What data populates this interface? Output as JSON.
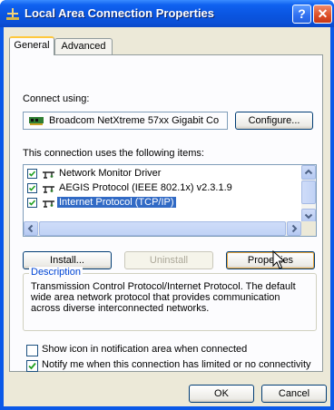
{
  "window": {
    "title": "Local Area Connection Properties",
    "help_label": "?",
    "close_label": "✕"
  },
  "tabs": [
    {
      "label": "General",
      "active": true
    },
    {
      "label": "Advanced",
      "active": false
    }
  ],
  "connect_using": {
    "label": "Connect using:",
    "device": "Broadcom NetXtreme 57xx Gigabit Co",
    "configure_button": "Configure..."
  },
  "items_section": {
    "label": "This connection uses the following items:",
    "items": [
      {
        "label": "Network Monitor Driver",
        "checked": true,
        "selected": false
      },
      {
        "label": "AEGIS Protocol (IEEE 802.1x) v2.3.1.9",
        "checked": true,
        "selected": false
      },
      {
        "label": "Internet Protocol (TCP/IP)",
        "checked": true,
        "selected": true
      }
    ]
  },
  "buttons": {
    "install": "Install...",
    "uninstall": "Uninstall",
    "properties": "Properties",
    "ok": "OK",
    "cancel": "Cancel"
  },
  "description": {
    "title": "Description",
    "text": "Transmission Control Protocol/Internet Protocol. The default wide area network protocol that provides communication across diverse interconnected networks."
  },
  "options": [
    {
      "label": "Show icon in notification area when connected",
      "checked": false
    },
    {
      "label": "Notify me when this connection has limited or no connectivity",
      "checked": true
    }
  ],
  "colors": {
    "titlebar": "#0a55e0",
    "selection": "#316ac5",
    "group_title": "#0046d5",
    "dialog_face": "#ece9d8"
  },
  "icons": {
    "title": "network-connection-icon",
    "device": "network-card-icon",
    "protocol": "network-protocol-icon",
    "cursor": "mouse-pointer-icon"
  }
}
